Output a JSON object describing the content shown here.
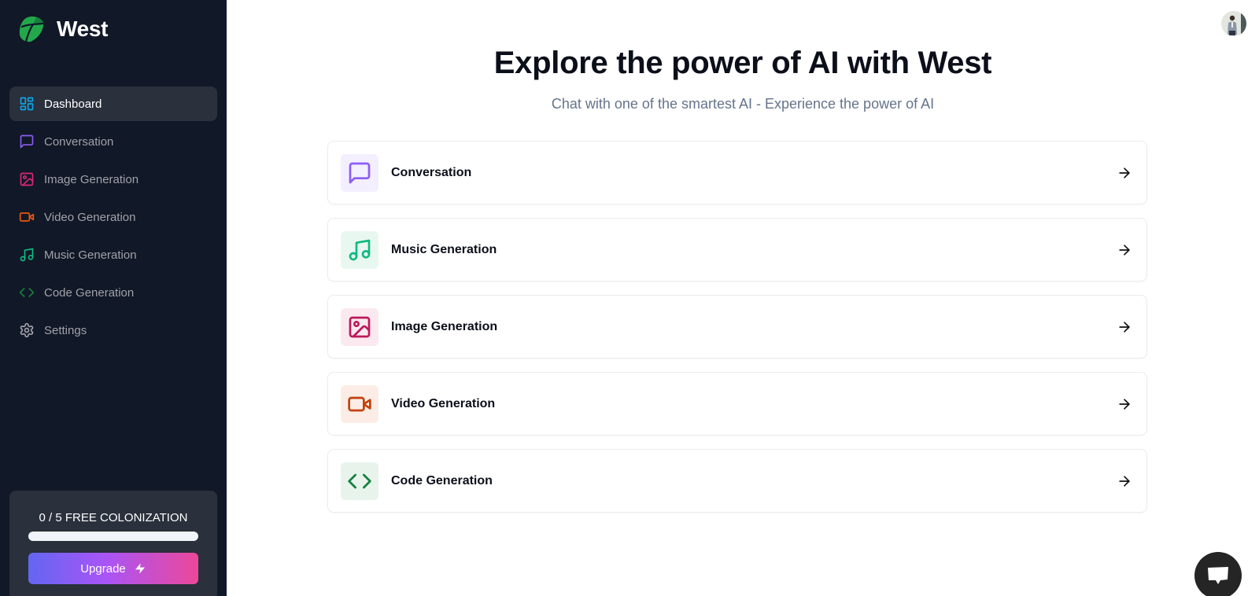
{
  "brand": {
    "name": "West",
    "logo_icon": "leaf-shield-logo"
  },
  "sidebar": {
    "items": [
      {
        "label": "Dashboard",
        "icon": "layout-dashboard-icon",
        "color": "#0ea5e9",
        "active": true
      },
      {
        "label": "Conversation",
        "icon": "message-square-icon",
        "color": "#8b5cf6",
        "active": false
      },
      {
        "label": "Image Generation",
        "icon": "image-icon",
        "color": "#db2777",
        "active": false
      },
      {
        "label": "Video Generation",
        "icon": "video-icon",
        "color": "#ea580c",
        "active": false
      },
      {
        "label": "Music Generation",
        "icon": "music-icon",
        "color": "#10b981",
        "active": false
      },
      {
        "label": "Code Generation",
        "icon": "code-icon",
        "color": "#15803d",
        "active": false
      },
      {
        "label": "Settings",
        "icon": "settings-icon",
        "color": "#a1a1aa",
        "active": false
      }
    ],
    "promo": {
      "usage_text": "0 / 5 FREE COLONIZATION",
      "used": 0,
      "limit": 5,
      "progress_fraction": 0,
      "upgrade_label": "Upgrade",
      "upgrade_icon": "zap-icon"
    }
  },
  "header": {
    "avatar_icon": "user-avatar"
  },
  "hero": {
    "title": "Explore the power of AI with West",
    "subtitle": "Chat with one of the smartest AI - Experience the power of AI"
  },
  "tools": [
    {
      "label": "Conversation",
      "icon": "message-square-icon",
      "color": "#8b5cf6",
      "bg": "#f3effe"
    },
    {
      "label": "Music Generation",
      "icon": "music-icon",
      "color": "#10b981",
      "bg": "#e8f8f1"
    },
    {
      "label": "Image Generation",
      "icon": "image-icon",
      "color": "#be185d",
      "bg": "#fbe9ef"
    },
    {
      "label": "Video Generation",
      "icon": "video-icon",
      "color": "#c2410c",
      "bg": "#fbede6"
    },
    {
      "label": "Code Generation",
      "icon": "code-icon",
      "color": "#15803d",
      "bg": "#e8f3ec"
    }
  ],
  "chat_widget": {
    "icon": "chat-bubble-icon"
  }
}
